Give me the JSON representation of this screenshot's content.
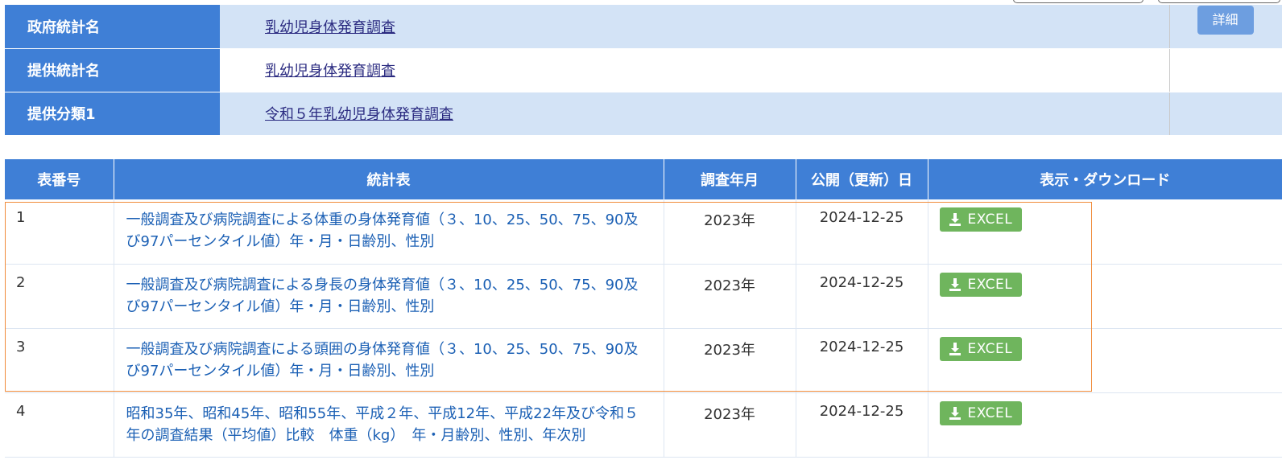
{
  "info": {
    "rows": [
      {
        "label": "政府統計名",
        "value": "乳幼児身体発育調査"
      },
      {
        "label": "提供統計名",
        "value": "乳幼児身体発育調査"
      },
      {
        "label": "提供分類1",
        "value": "令和５年乳幼児身体発育調査"
      }
    ],
    "detail_label": "詳細"
  },
  "list": {
    "headers": [
      "表番号",
      "統計表",
      "調査年月",
      "公開（更新）日",
      "表示・ダウンロード"
    ],
    "download_label": "EXCEL",
    "rows": [
      {
        "no": "1",
        "title": "一般調査及び病院調査による体重の身体発育値（３、10、25、50、75、90及び97パーセンタイル値）年・月・日齢別、性別",
        "survey": "2023年",
        "published": "2024-12-25"
      },
      {
        "no": "2",
        "title": "一般調査及び病院調査による身長の身体発育値（３、10、25、50、75、90及び97パーセンタイル値）年・月・日齢別、性別",
        "survey": "2023年",
        "published": "2024-12-25"
      },
      {
        "no": "3",
        "title": "一般調査及び病院調査による頭囲の身体発育値（３、10、25、50、75、90及び97パーセンタイル値）年・月・日齢別、性別",
        "survey": "2023年",
        "published": "2024-12-25"
      },
      {
        "no": "4",
        "title": "昭和35年、昭和45年、昭和55年、平成２年、平成12年、平成22年及び令和５年の調査結果（平均値）比較　体重（kg）　年・月齢別、性別、年次別",
        "survey": "2023年",
        "published": "2024-12-25"
      }
    ]
  },
  "colors": {
    "header_blue": "#3f7fd6",
    "row_alt": "#d3e3f6",
    "excel_green": "#6fb55d",
    "link_blue": "#1a5fb4",
    "highlight_orange": "#f08b3a"
  }
}
